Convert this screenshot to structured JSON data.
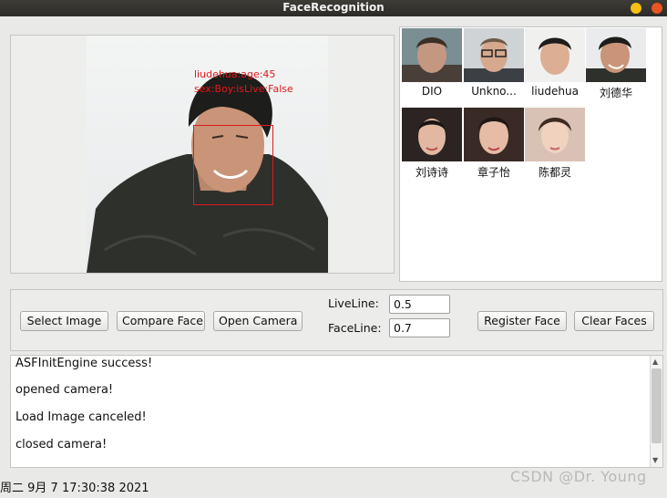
{
  "window": {
    "title": "FaceRecognition"
  },
  "preview": {
    "label_line1": "liudehua:age:45",
    "label_line2": "sex:Boy:isLive:False"
  },
  "gallery": {
    "faces": [
      {
        "name": "DIO"
      },
      {
        "name": "Unkno..."
      },
      {
        "name": "liudehua"
      },
      {
        "name": "刘德华"
      },
      {
        "name": "刘诗诗"
      },
      {
        "name": "章子怡"
      },
      {
        "name": "陈都灵"
      }
    ]
  },
  "controls": {
    "select_image": "Select Image",
    "compare_face": "Compare Face",
    "open_camera": "Open Camera",
    "liveline_label": "LiveLine:",
    "liveline_value": "0.5",
    "faceline_label": "FaceLine:",
    "faceline_value": "0.7",
    "register_face": "Register Face",
    "clear_faces": "Clear Faces"
  },
  "log": {
    "lines": [
      "ASFInitEngine success!",
      "opened camera!",
      "Load Image canceled!",
      "closed camera!"
    ]
  },
  "status": {
    "datetime": "周二 9月 7 17:30:38 2021"
  },
  "watermark": {
    "text": "CSDN @Dr. Young"
  },
  "colors": {
    "title_bg": "#2c2b28",
    "detect_red": "#e01b1b",
    "close": "#e95420",
    "minimize": "#f5c211"
  }
}
